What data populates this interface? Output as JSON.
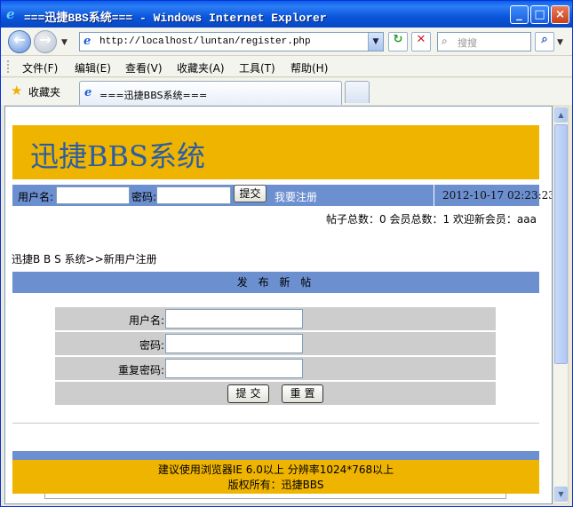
{
  "window": {
    "title": "===迅捷BBS系统=== - Windows Internet Explorer",
    "min_label": "_",
    "max_label": "□",
    "close_label": "×"
  },
  "address_bar": {
    "url": "http://localhost/luntan/register.php",
    "search_placeholder": "搜搜",
    "back_glyph": "←",
    "forward_glyph": "→",
    "refresh_glyph": "↻",
    "stop_glyph": "✕",
    "search_glyph": "🔍"
  },
  "menu": [
    {
      "label": "文件(F)"
    },
    {
      "label": "编辑(E)"
    },
    {
      "label": "查看(V)"
    },
    {
      "label": "收藏夹(A)"
    },
    {
      "label": "工具(T)"
    },
    {
      "label": "帮助(H)"
    }
  ],
  "favorites_label": "收藏夹",
  "tab": {
    "label": "===迅捷BBS系统==="
  },
  "page": {
    "site_title": "迅捷BBS系统",
    "login": {
      "username_label": "用户名:",
      "password_label": "密码:",
      "submit_label": "提交",
      "register_link": "我要注册",
      "datetime": "2012-10-17 02:23:23"
    },
    "stats": "帖子总数：0 会员总数：1 欢迎新会员：aaa",
    "breadcrumb": "迅捷B B S 系统>>新用户注册",
    "section_title": "发 布 新 帖",
    "form": {
      "username_label": "用户名:",
      "password_label": "密码:",
      "confirm_label": "重复密码:",
      "submit_label": "提交",
      "reset_label": "重置"
    },
    "footer": {
      "line1": "建议使用浏览器IE 6.0以上 分辨率1024*768以上",
      "line2": "版权所有：迅捷BBS"
    }
  },
  "colors": {
    "banner": "#efb400",
    "bar_blue": "#6b8fcf",
    "title_text": "#2c5da3"
  }
}
